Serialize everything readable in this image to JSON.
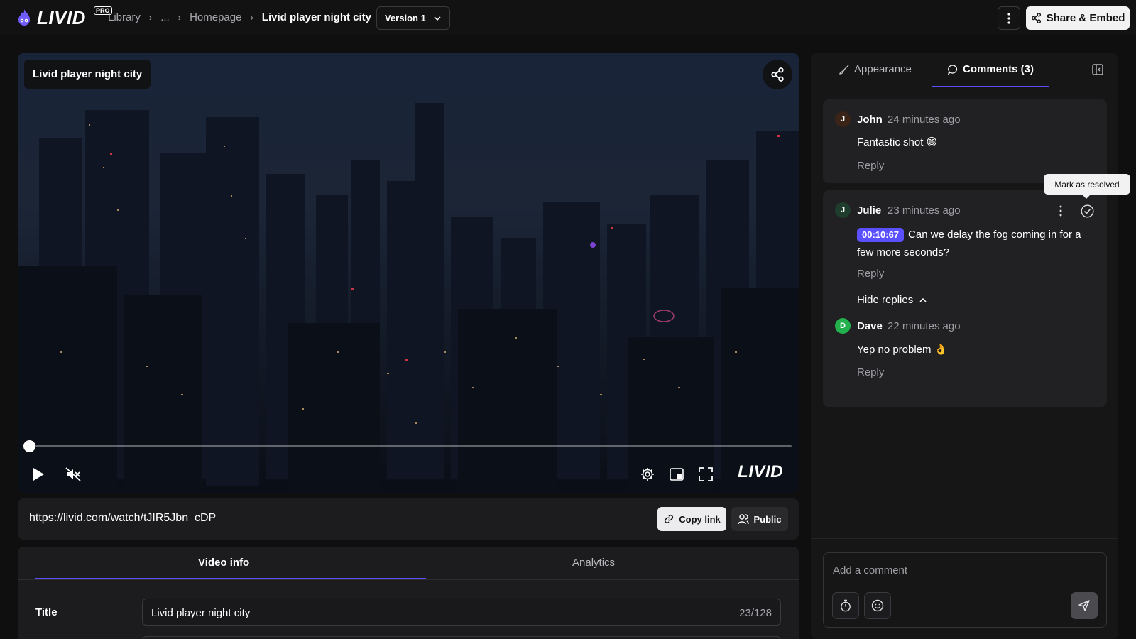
{
  "app": {
    "logo_text": "LIVID",
    "pro_badge": "PRO"
  },
  "breadcrumb": {
    "items": [
      "Library",
      "...",
      "Homepage"
    ],
    "current": "Livid player night city"
  },
  "version": {
    "selected": "Version 1"
  },
  "header": {
    "share_label": "Share & Embed"
  },
  "player": {
    "title": "Livid player night city",
    "progress": 0,
    "watermark": "LIVID",
    "icons": [
      "play-icon",
      "mute-icon",
      "settings-icon",
      "pip-icon",
      "fullscreen-icon",
      "share-icon"
    ]
  },
  "link": {
    "url": "https://livid.com/watch/tJIR5Jbn_cDP",
    "copy_label": "Copy link",
    "visibility_label": "Public"
  },
  "info": {
    "tabs": [
      {
        "label": "Video info",
        "active": true
      },
      {
        "label": "Analytics",
        "active": false
      }
    ],
    "title_label": "Title",
    "title_value": "Livid player night city",
    "title_count": "23/128"
  },
  "sidebar": {
    "tabs": [
      {
        "label": "Appearance",
        "active": false
      },
      {
        "label": "Comments (3)",
        "active": true
      }
    ],
    "tooltip": "Mark as resolved",
    "comments": [
      {
        "initial": "J",
        "name": "John",
        "time": "24 minutes ago",
        "text": "Fantastic shot 😄",
        "reply_label": "Reply",
        "avatar_color": "#3a2418"
      },
      {
        "initial": "J",
        "name": "Julie",
        "time": "23 minutes ago",
        "timestamp": "00:10:67",
        "text": "Can we delay the fog coming in for a few more seconds?",
        "reply_label": "Reply",
        "hide_replies_label": "Hide replies",
        "avatar_color": "#1f3d2c",
        "replies": [
          {
            "initial": "D",
            "name": "Dave",
            "time": "22 minutes ago",
            "text": "Yep no problem 👌",
            "reply_label": "Reply",
            "avatar_color": "#22b14c"
          }
        ]
      }
    ],
    "composer": {
      "placeholder": "Add a comment"
    }
  },
  "colors": {
    "accent": "#5b50ff",
    "background": "#0f0f10",
    "panel": "#1c1c1e"
  }
}
